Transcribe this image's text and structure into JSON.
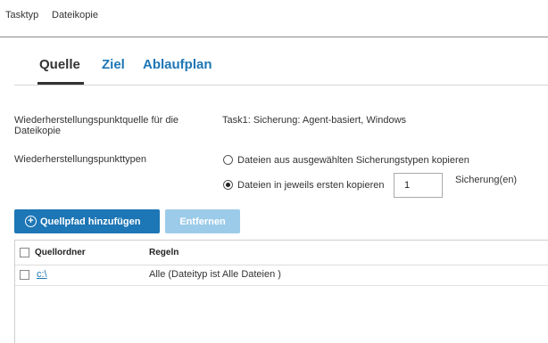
{
  "topbar": {
    "task_type": "Tasktyp",
    "file_copy": "Dateikopie"
  },
  "tabs": [
    {
      "label": "Quelle",
      "active": true
    },
    {
      "label": "Ziel",
      "active": false
    },
    {
      "label": "Ablaufplan",
      "active": false
    }
  ],
  "form": {
    "source_label": "Wiederherstellungspunktquelle für die Dateikopie",
    "source_value": "Task1: Sicherung: Agent-basiert, Windows",
    "types_label": "Wiederherstellungspunkttypen",
    "option1": "Dateien aus ausgewählten Sicherungstypen kopieren",
    "option2": "Dateien in jeweils ersten kopieren",
    "copies_value": "1",
    "copies_unit": "Sicherung(en)",
    "selected_option": 2
  },
  "buttons": {
    "add": "Quellpfad hinzufügen",
    "remove": "Entfernen"
  },
  "table": {
    "headers": [
      "Quellordner",
      "Regeln"
    ],
    "rows": [
      {
        "folder": "c:\\",
        "rules": "Alle (Dateityp ist Alle Dateien )"
      }
    ]
  },
  "colors": {
    "accent": "#1d76b5",
    "disabled_button": "#9ccbe9"
  }
}
